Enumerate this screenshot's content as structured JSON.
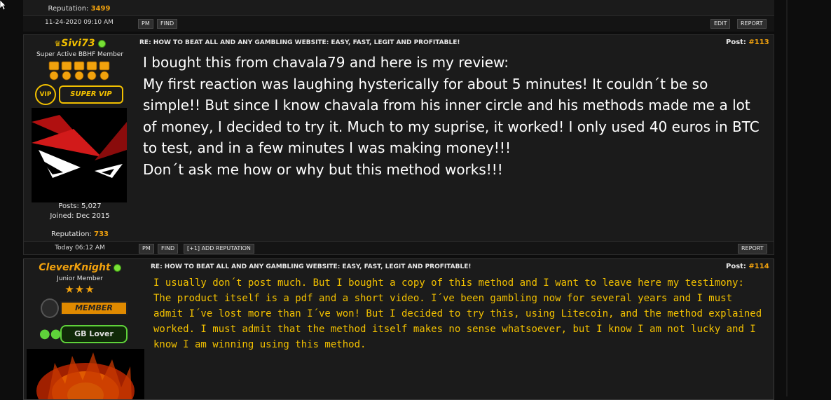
{
  "previous_post": {
    "reputation_label": "Reputation:",
    "reputation_value": "3499",
    "date": "11-24-2020 09:10 AM",
    "buttons": {
      "pm": "PM",
      "find": "FIND",
      "edit": "EDIT",
      "report": "REPORT"
    }
  },
  "posts": [
    {
      "username": "Sivi73",
      "username_color": "#f2c000",
      "online": true,
      "rank": "Super Active BBHF Member",
      "badge_text": "SUPER VIP",
      "badge_prefix": "VIP",
      "subject": "RE: HOW TO BEAT ALL AND ANY GAMBLING WEBSITE: EASY, FAST, LEGIT AND PROFITABLE!",
      "post_label": "Post:",
      "post_number": "#113",
      "posts_label": "Posts: 5,027",
      "joined_label": "Joined: Dec 2015",
      "reputation_label": "Reputation:",
      "reputation_value": "733",
      "date": "Today 06:12 AM",
      "buttons": {
        "pm": "PM",
        "find": "FIND",
        "add_rep": "[+1] ADD REPUTATION",
        "report": "REPORT"
      },
      "message_lines": [
        "I bought this from chavala79 and here is my review:",
        "My first reaction was laughing hysterically for about 5 minutes! It couldn´t be so simple!! But since I know chavala from his inner circle and his methods made me a lot of money, I decided to try it. Much to my suprise, it worked! I only used 40 euros in BTC to test, and in a few minutes I was making money!!!",
        "Don´t ask me how or why but this method works!!!"
      ]
    },
    {
      "username": "CleverKnight",
      "username_color": "#f2a20d",
      "online": true,
      "rank": "Junior Member",
      "badge_text": "MEMBER",
      "badge2_text": "GB Lover",
      "subject": "RE: HOW TO BEAT ALL AND ANY GAMBLING WEBSITE: EASY, FAST, LEGIT AND PROFITABLE!",
      "post_label": "Post:",
      "post_number": "#114",
      "message_lines": [
        "I usually don´t post much. But I bought a copy of this method and I want to leave here my testimony:",
        "The product itself is a pdf and a short video. I´ve been gambling now for several years and I must admit I´ve lost more than I´ve won! But I decided to try this, using Litecoin, and the method explained worked. I must admit that the method itself makes no sense whatsoever, but I know I am not lucky and I know I am winning using this method."
      ]
    }
  ]
}
